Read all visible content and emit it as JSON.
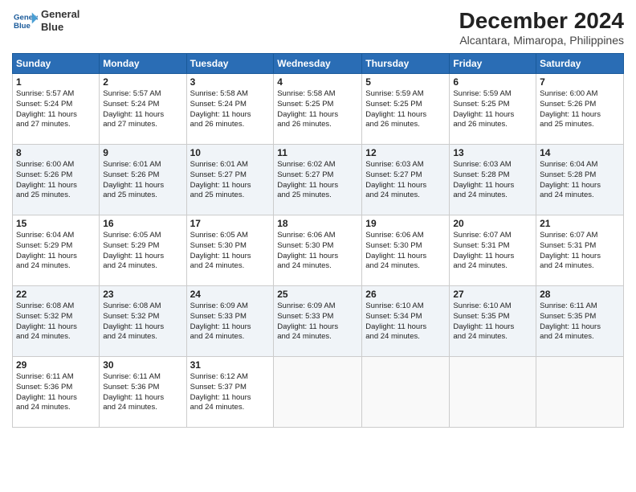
{
  "logo": {
    "line1": "General",
    "line2": "Blue"
  },
  "title": "December 2024",
  "subtitle": "Alcantara, Mimaropa, Philippines",
  "days_of_week": [
    "Sunday",
    "Monday",
    "Tuesday",
    "Wednesday",
    "Thursday",
    "Friday",
    "Saturday"
  ],
  "weeks": [
    [
      {
        "day": "1",
        "info": "Sunrise: 5:57 AM\nSunset: 5:24 PM\nDaylight: 11 hours\nand 27 minutes."
      },
      {
        "day": "2",
        "info": "Sunrise: 5:57 AM\nSunset: 5:24 PM\nDaylight: 11 hours\nand 27 minutes."
      },
      {
        "day": "3",
        "info": "Sunrise: 5:58 AM\nSunset: 5:24 PM\nDaylight: 11 hours\nand 26 minutes."
      },
      {
        "day": "4",
        "info": "Sunrise: 5:58 AM\nSunset: 5:25 PM\nDaylight: 11 hours\nand 26 minutes."
      },
      {
        "day": "5",
        "info": "Sunrise: 5:59 AM\nSunset: 5:25 PM\nDaylight: 11 hours\nand 26 minutes."
      },
      {
        "day": "6",
        "info": "Sunrise: 5:59 AM\nSunset: 5:25 PM\nDaylight: 11 hours\nand 26 minutes."
      },
      {
        "day": "7",
        "info": "Sunrise: 6:00 AM\nSunset: 5:26 PM\nDaylight: 11 hours\nand 25 minutes."
      }
    ],
    [
      {
        "day": "8",
        "info": "Sunrise: 6:00 AM\nSunset: 5:26 PM\nDaylight: 11 hours\nand 25 minutes."
      },
      {
        "day": "9",
        "info": "Sunrise: 6:01 AM\nSunset: 5:26 PM\nDaylight: 11 hours\nand 25 minutes."
      },
      {
        "day": "10",
        "info": "Sunrise: 6:01 AM\nSunset: 5:27 PM\nDaylight: 11 hours\nand 25 minutes."
      },
      {
        "day": "11",
        "info": "Sunrise: 6:02 AM\nSunset: 5:27 PM\nDaylight: 11 hours\nand 25 minutes."
      },
      {
        "day": "12",
        "info": "Sunrise: 6:03 AM\nSunset: 5:27 PM\nDaylight: 11 hours\nand 24 minutes."
      },
      {
        "day": "13",
        "info": "Sunrise: 6:03 AM\nSunset: 5:28 PM\nDaylight: 11 hours\nand 24 minutes."
      },
      {
        "day": "14",
        "info": "Sunrise: 6:04 AM\nSunset: 5:28 PM\nDaylight: 11 hours\nand 24 minutes."
      }
    ],
    [
      {
        "day": "15",
        "info": "Sunrise: 6:04 AM\nSunset: 5:29 PM\nDaylight: 11 hours\nand 24 minutes."
      },
      {
        "day": "16",
        "info": "Sunrise: 6:05 AM\nSunset: 5:29 PM\nDaylight: 11 hours\nand 24 minutes."
      },
      {
        "day": "17",
        "info": "Sunrise: 6:05 AM\nSunset: 5:30 PM\nDaylight: 11 hours\nand 24 minutes."
      },
      {
        "day": "18",
        "info": "Sunrise: 6:06 AM\nSunset: 5:30 PM\nDaylight: 11 hours\nand 24 minutes."
      },
      {
        "day": "19",
        "info": "Sunrise: 6:06 AM\nSunset: 5:30 PM\nDaylight: 11 hours\nand 24 minutes."
      },
      {
        "day": "20",
        "info": "Sunrise: 6:07 AM\nSunset: 5:31 PM\nDaylight: 11 hours\nand 24 minutes."
      },
      {
        "day": "21",
        "info": "Sunrise: 6:07 AM\nSunset: 5:31 PM\nDaylight: 11 hours\nand 24 minutes."
      }
    ],
    [
      {
        "day": "22",
        "info": "Sunrise: 6:08 AM\nSunset: 5:32 PM\nDaylight: 11 hours\nand 24 minutes."
      },
      {
        "day": "23",
        "info": "Sunrise: 6:08 AM\nSunset: 5:32 PM\nDaylight: 11 hours\nand 24 minutes."
      },
      {
        "day": "24",
        "info": "Sunrise: 6:09 AM\nSunset: 5:33 PM\nDaylight: 11 hours\nand 24 minutes."
      },
      {
        "day": "25",
        "info": "Sunrise: 6:09 AM\nSunset: 5:33 PM\nDaylight: 11 hours\nand 24 minutes."
      },
      {
        "day": "26",
        "info": "Sunrise: 6:10 AM\nSunset: 5:34 PM\nDaylight: 11 hours\nand 24 minutes."
      },
      {
        "day": "27",
        "info": "Sunrise: 6:10 AM\nSunset: 5:35 PM\nDaylight: 11 hours\nand 24 minutes."
      },
      {
        "day": "28",
        "info": "Sunrise: 6:11 AM\nSunset: 5:35 PM\nDaylight: 11 hours\nand 24 minutes."
      }
    ],
    [
      {
        "day": "29",
        "info": "Sunrise: 6:11 AM\nSunset: 5:36 PM\nDaylight: 11 hours\nand 24 minutes."
      },
      {
        "day": "30",
        "info": "Sunrise: 6:11 AM\nSunset: 5:36 PM\nDaylight: 11 hours\nand 24 minutes."
      },
      {
        "day": "31",
        "info": "Sunrise: 6:12 AM\nSunset: 5:37 PM\nDaylight: 11 hours\nand 24 minutes."
      },
      {
        "day": "",
        "info": ""
      },
      {
        "day": "",
        "info": ""
      },
      {
        "day": "",
        "info": ""
      },
      {
        "day": "",
        "info": ""
      }
    ]
  ]
}
